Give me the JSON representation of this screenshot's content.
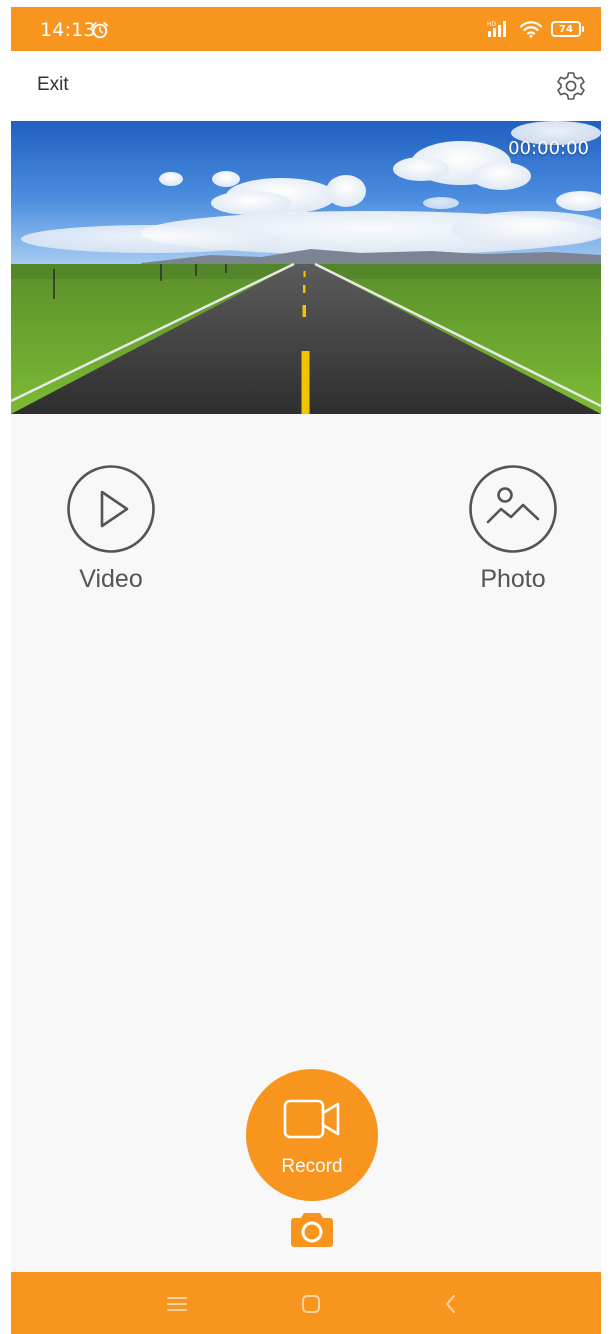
{
  "status_bar": {
    "time": "14:13",
    "battery_level": "74",
    "icons": [
      "alarm-icon",
      "signal-icon",
      "wifi-icon",
      "battery-icon"
    ],
    "color": "#f7951e"
  },
  "header": {
    "exit_label": "Exit",
    "settings_icon": "gear-icon"
  },
  "preview": {
    "timer": "00:00:00"
  },
  "media": {
    "video_label": "Video",
    "photo_label": "Photo",
    "video_icon": "play-icon",
    "photo_icon": "gallery-icon"
  },
  "record": {
    "label": "Record",
    "icon": "video-camera-icon",
    "snapshot_icon": "camera-icon"
  },
  "nav_bar": {
    "icons": [
      "menu-icon",
      "home-icon",
      "back-icon"
    ]
  },
  "colors": {
    "accent": "#f7951e",
    "background": "#f8f8f8",
    "icon_gray": "#555555"
  }
}
